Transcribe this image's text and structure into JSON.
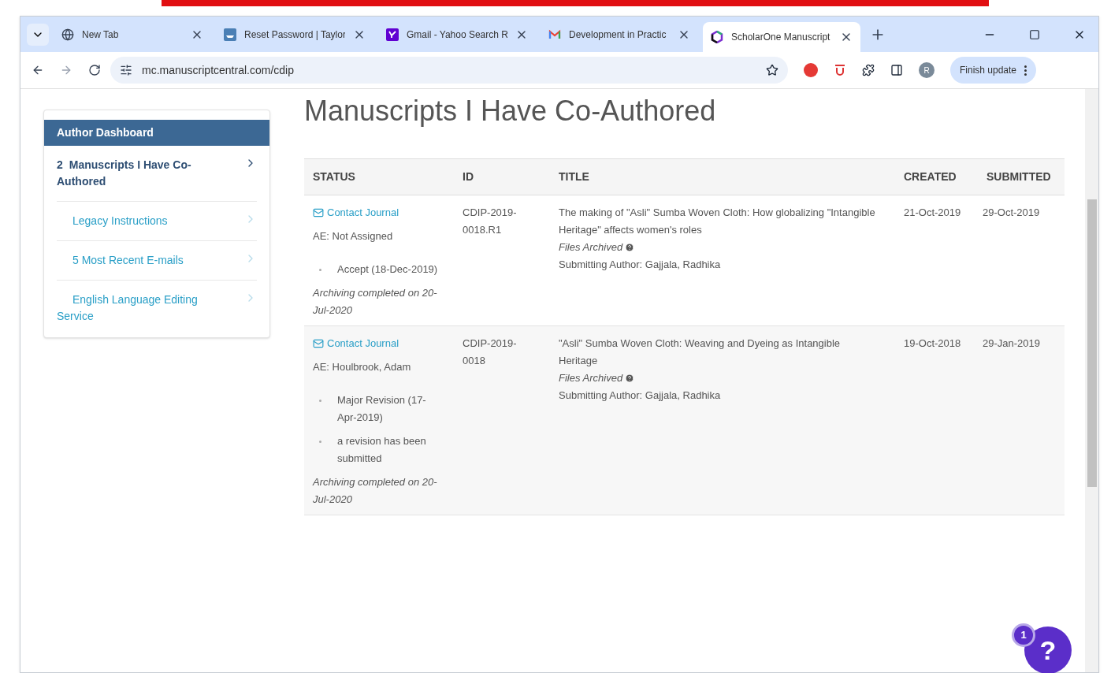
{
  "browser": {
    "tabs": [
      {
        "kind": "globe",
        "title": "New Tab",
        "selected": false
      },
      {
        "kind": "taylor",
        "title": "Reset Password | Taylor",
        "selected": false
      },
      {
        "kind": "yahoo",
        "title": "Gmail - Yahoo Search R",
        "selected": false
      },
      {
        "kind": "gmail",
        "title": "Development in Practic",
        "selected": false
      },
      {
        "kind": "scholarone",
        "title": "ScholarOne Manuscript",
        "selected": true
      }
    ],
    "url": "mc.manuscriptcentral.com/cdip",
    "update_button": "Finish update",
    "profile_initial": "R"
  },
  "page": {
    "heading": "Manuscripts I Have Co-Authored",
    "sidebar": {
      "title": "Author Dashboard",
      "items": [
        {
          "count": "2",
          "label": "Manuscripts I Have Co-Authored",
          "selected": true
        },
        {
          "label": "Legacy Instructions",
          "selected": false
        },
        {
          "label": "5 Most Recent E-mails",
          "selected": false
        },
        {
          "label": "English Language Editing Service",
          "selected": false
        }
      ]
    },
    "table": {
      "columns": [
        "STATUS",
        "ID",
        "TITLE",
        "CREATED",
        "SUBMITTED"
      ],
      "rows": [
        {
          "contact": "Contact Journal",
          "ae": "AE: Not Assigned",
          "decisions": [
            "Accept (18-Dec-2019)"
          ],
          "archived": "Archiving completed on 20-Jul-2020",
          "id": "CDIP-2019-0018.R1",
          "title": "The making of \"Asli\" Sumba Woven Cloth: How globalizing \"Intangible Heritage\" affects women's roles",
          "files": "Files Archived",
          "author": "Submitting Author: Gajjala, Radhika",
          "created": "21-Oct-2019",
          "submitted": "29-Oct-2019"
        },
        {
          "contact": "Contact Journal",
          "ae": "AE: Houlbrook, Adam",
          "decisions": [
            "Major Revision (17-Apr-2019)",
            "a revision has been submitted"
          ],
          "archived": "Archiving completed on 20-Jul-2020",
          "id": "CDIP-2019-0018",
          "title": "\"Asli\" Sumba Woven Cloth: Weaving and Dyeing as Intangible Heritage",
          "files": "Files Archived",
          "author": "Submitting Author: Gajjala, Radhika",
          "created": "19-Oct-2018",
          "submitted": "29-Jan-2019"
        }
      ]
    },
    "help": {
      "symbol": "?",
      "badge": "1"
    }
  }
}
